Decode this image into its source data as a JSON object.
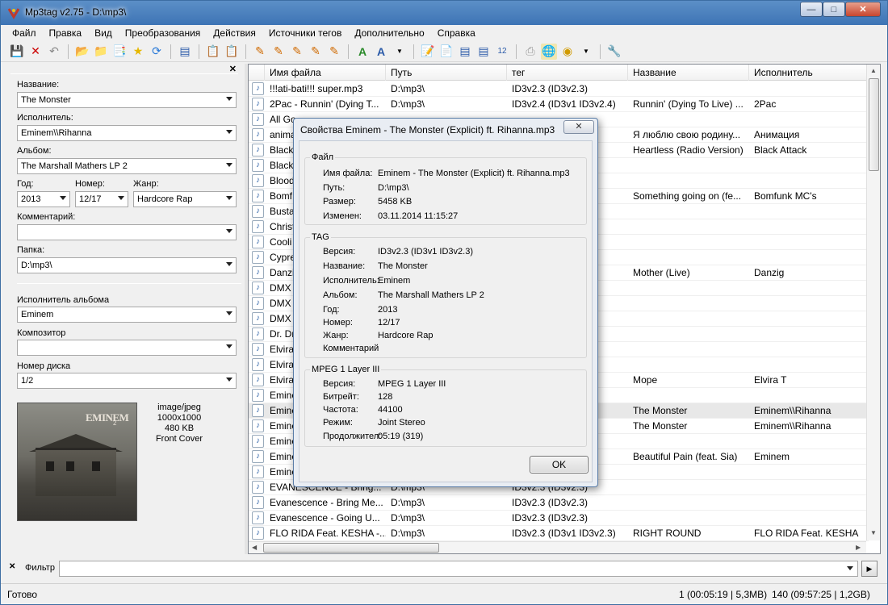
{
  "window": {
    "title": "Mp3tag v2.75  -  D:\\mp3\\"
  },
  "menu": [
    "Файл",
    "Правка",
    "Вид",
    "Преобразования",
    "Действия",
    "Источники тегов",
    "Дополнительно",
    "Справка"
  ],
  "left_panel": {
    "title_label": "Название:",
    "title_value": "The Monster",
    "artist_label": "Исполнитель:",
    "artist_value": "Eminem\\\\Rihanna",
    "album_label": "Альбом:",
    "album_value": "The Marshall Mathers LP 2",
    "year_label": "Год:",
    "year_value": "2013",
    "track_label": "Номер:",
    "track_value": "12/17",
    "genre_label": "Жанр:",
    "genre_value": "Hardcore Rap",
    "comment_label": "Комментарий:",
    "comment_value": "",
    "folder_label": "Папка:",
    "folder_value": "D:\\mp3\\",
    "album_artist_label": "Исполнитель альбома",
    "album_artist_value": "Eminem",
    "composer_label": "Композитор",
    "composer_value": "",
    "disc_label": "Номер диска",
    "disc_value": "1/2",
    "cover_info": {
      "mime": "image/jpeg",
      "dims": "1000x1000",
      "size": "480 KB",
      "type": "Front Cover"
    },
    "cover_logo": "EMINEM",
    "cover_logo_sub": "2"
  },
  "grid": {
    "columns": [
      "Имя файла",
      "Путь",
      "тег",
      "Название",
      "Исполнитель"
    ],
    "rows": [
      {
        "file": "!!!ati-bati!!! super.mp3",
        "path": "D:\\mp3\\",
        "tag": "ID3v2.3 (ID3v2.3)",
        "title": "",
        "artist": ""
      },
      {
        "file": "2Pac - Runnin' (Dying T...",
        "path": "D:\\mp3\\",
        "tag": "ID3v2.4 (ID3v1 ID3v2.4)",
        "title": "Runnin' (Dying To Live) ...",
        "artist": "2Pac"
      },
      {
        "file": "All Go",
        "path": "",
        "tag": "",
        "title": "",
        "artist": ""
      },
      {
        "file": "anima",
        "path": "",
        "tag": "",
        "title": "Я люблю свою родину...",
        "artist": "Анимация"
      },
      {
        "file": "Black",
        "path": "",
        "tag": "4)",
        "title": "Heartless (Radio Version)",
        "artist": "Black Attack"
      },
      {
        "file": "Black",
        "path": "",
        "tag": "",
        "title": "",
        "artist": ""
      },
      {
        "file": "Blood",
        "path": "",
        "tag": "",
        "title": "",
        "artist": ""
      },
      {
        "file": "Bomf",
        "path": "",
        "tag": "v2...",
        "title": "Something going on (fe...",
        "artist": "Bomfunk MC's"
      },
      {
        "file": "Busta",
        "path": "",
        "tag": "",
        "title": "",
        "artist": ""
      },
      {
        "file": "Christ",
        "path": "",
        "tag": "",
        "title": "",
        "artist": ""
      },
      {
        "file": "Cooli",
        "path": "",
        "tag": "",
        "title": "",
        "artist": ""
      },
      {
        "file": "Cypre",
        "path": "",
        "tag": "",
        "title": "",
        "artist": ""
      },
      {
        "file": "Danzi",
        "path": "",
        "tag": "v2...",
        "title": "Mother (Live)",
        "artist": "Danzig"
      },
      {
        "file": "DMX",
        "path": "",
        "tag": "",
        "title": "",
        "artist": ""
      },
      {
        "file": "DMX",
        "path": "",
        "tag": "",
        "title": "",
        "artist": ""
      },
      {
        "file": "DMX",
        "path": "",
        "tag": "",
        "title": "",
        "artist": ""
      },
      {
        "file": "Dr. Dr",
        "path": "",
        "tag": "",
        "title": "",
        "artist": ""
      },
      {
        "file": "Elvira",
        "path": "",
        "tag": "",
        "title": "",
        "artist": ""
      },
      {
        "file": "Elvira",
        "path": "",
        "tag": "",
        "title": "",
        "artist": ""
      },
      {
        "file": "Elvira",
        "path": "",
        "tag": "v2...",
        "title": "Море",
        "artist": "Elvira T"
      },
      {
        "file": "Emine",
        "path": "",
        "tag": "v2...",
        "title": "",
        "artist": ""
      },
      {
        "file": "Emine",
        "path": "",
        "tag": "3)",
        "title": "The Monster",
        "artist": "Eminem\\\\Rihanna"
      },
      {
        "file": "Emine",
        "path": "",
        "tag": "3)",
        "title": "The Monster",
        "artist": "Eminem\\\\Rihanna"
      },
      {
        "file": "Emine",
        "path": "",
        "tag": "",
        "title": "",
        "artist": ""
      },
      {
        "file": "Emine",
        "path": "",
        "tag": "3)",
        "title": "Beautiful Pain (feat. Sia)",
        "artist": "Eminem"
      },
      {
        "file": "Emine",
        "path": "",
        "tag": "",
        "title": "",
        "artist": ""
      },
      {
        "file": "EVANESCENCE - Bring...",
        "path": "D:\\mp3\\",
        "tag": "ID3v2.3 (ID3v2.3)",
        "title": "",
        "artist": ""
      },
      {
        "file": "Evanescence - Bring Me...",
        "path": "D:\\mp3\\",
        "tag": "ID3v2.3 (ID3v2.3)",
        "title": "",
        "artist": ""
      },
      {
        "file": "Evanescence - Going U...",
        "path": "D:\\mp3\\",
        "tag": "ID3v2.3 (ID3v2.3)",
        "title": "",
        "artist": ""
      },
      {
        "file": "FLO RIDA Feat. KESHA -...",
        "path": "D:\\mp3\\",
        "tag": "ID3v2.3 (ID3v1 ID3v2.3)",
        "title": "RIGHT ROUND",
        "artist": "FLO RIDA Feat. KESHA"
      }
    ],
    "selected_row": 21
  },
  "filter": {
    "label": "Фильтр",
    "value": ""
  },
  "status": {
    "left": "Готово",
    "selection": "1 (00:05:19 | 5,3MB)",
    "total": "140 (09:57:25 | 1,2GB)"
  },
  "dialog": {
    "title": "Свойства Eminem - The Monster (Explicit) ft. Rihanna.mp3",
    "close_label": "✕",
    "file_group": {
      "title": "Файл",
      "rows": [
        {
          "k": "Имя файла:",
          "v": "Eminem - The Monster (Explicit) ft. Rihanna.mp3"
        },
        {
          "k": "Путь:",
          "v": "D:\\mp3\\"
        },
        {
          "k": "Размер:",
          "v": "5458 KB"
        },
        {
          "k": "Изменен:",
          "v": "03.11.2014 11:15:27"
        }
      ]
    },
    "tag_group": {
      "title": "TAG",
      "rows": [
        {
          "k": "Версия:",
          "v": "ID3v2.3 (ID3v1 ID3v2.3)"
        },
        {
          "k": "Название:",
          "v": "The Monster"
        },
        {
          "k": "Исполнитель:",
          "v": "Eminem"
        },
        {
          "k": "Альбом:",
          "v": "The Marshall Mathers LP 2"
        },
        {
          "k": "Год:",
          "v": "2013"
        },
        {
          "k": "Номер:",
          "v": "12/17"
        },
        {
          "k": "Жанр:",
          "v": "Hardcore Rap"
        },
        {
          "k": "Комментарий",
          "v": ""
        }
      ]
    },
    "mpeg_group": {
      "title": "MPEG 1 Layer III",
      "rows": [
        {
          "k": "Версия:",
          "v": "MPEG 1 Layer III"
        },
        {
          "k": "Битрейт:",
          "v": "128"
        },
        {
          "k": "Частота:",
          "v": "44100"
        },
        {
          "k": "Режим:",
          "v": "Joint Stereo"
        },
        {
          "k": "Продолжител:",
          "v": "05:19 (319)"
        }
      ]
    },
    "ok_label": "OK"
  },
  "colors": {
    "titlebar": "#3d74b5",
    "selection": "#e8e8e8",
    "close": "#c8452e"
  }
}
